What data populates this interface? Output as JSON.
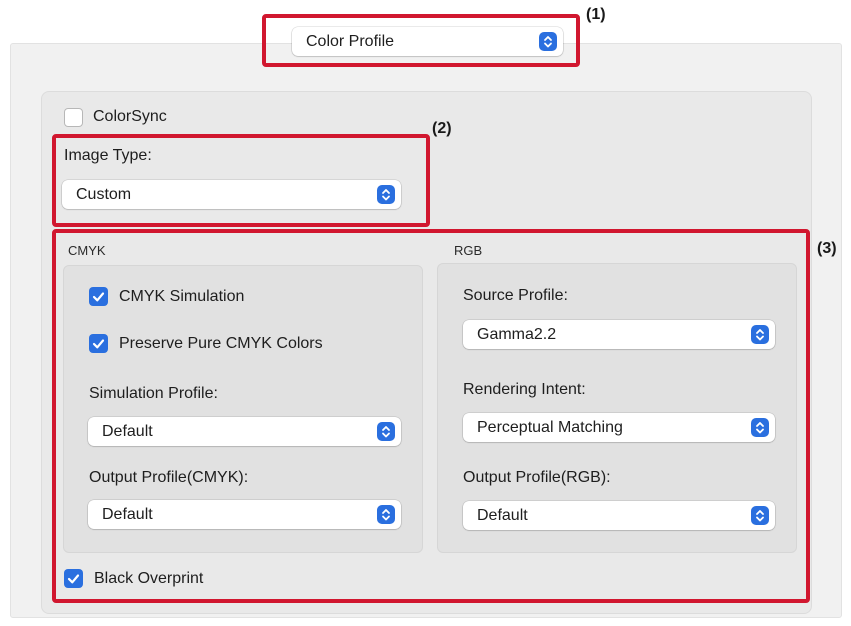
{
  "top_select": {
    "value": "Color Profile"
  },
  "colorsync": {
    "label": "ColorSync",
    "checked": false
  },
  "image_type": {
    "label": "Image Type:",
    "value": "Custom"
  },
  "cmyk": {
    "section_label": "CMYK",
    "simulation": {
      "label": "CMYK Simulation",
      "checked": true
    },
    "preserve": {
      "label": "Preserve Pure CMYK Colors",
      "checked": true
    },
    "simulation_profile": {
      "label": "Simulation Profile:",
      "value": "Default"
    },
    "output_profile": {
      "label": "Output Profile(CMYK):",
      "value": "Default"
    }
  },
  "rgb": {
    "section_label": "RGB",
    "source_profile": {
      "label": "Source Profile:",
      "value": "Gamma2.2"
    },
    "rendering_intent": {
      "label": "Rendering Intent:",
      "value": "Perceptual Matching"
    },
    "output_profile": {
      "label": "Output Profile(RGB):",
      "value": "Default"
    }
  },
  "black_overprint": {
    "label": "Black Overprint",
    "checked": true
  },
  "callouts": {
    "one": "(1)",
    "two": "(2)",
    "three": "(3)"
  },
  "colors": {
    "accent": "#2a6fdf",
    "highlight": "#d1172f"
  },
  "icons": {
    "chevron": "up-down-chevron-icon",
    "check": "checkmark-icon"
  }
}
